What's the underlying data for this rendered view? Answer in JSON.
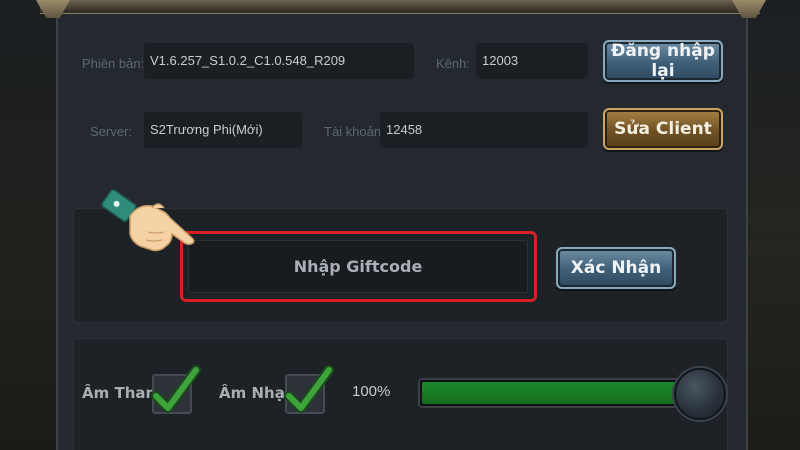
{
  "info": {
    "version_label": "Phiên bản:",
    "version_value": "V1.6.257_S1.0.2_C1.0.548_R209",
    "channel_label": "Kênh:",
    "channel_value": "12003",
    "server_label": "Server:",
    "server_value": "S2Trương Phi(Mới)",
    "account_label": "Tài khoản:",
    "account_value": "12458"
  },
  "buttons": {
    "relogin": "Đăng nhập lại",
    "fix_client": "Sửa Client",
    "confirm": "Xác Nhận"
  },
  "giftcode": {
    "placeholder": "Nhập Giftcode"
  },
  "sound": {
    "sfx_label": "Âm Thanh",
    "music_label": "Âm Nhạc",
    "volume_text": "100%",
    "volume_fraction": 1.0,
    "sfx_checked": true,
    "music_checked": true
  },
  "colors": {
    "highlight": "#d81f26",
    "check": "#3fa33c",
    "volume_fill": "#1e8a2a"
  },
  "icons": {
    "pointer": "pointing-hand-icon",
    "check": "checkmark-icon"
  }
}
